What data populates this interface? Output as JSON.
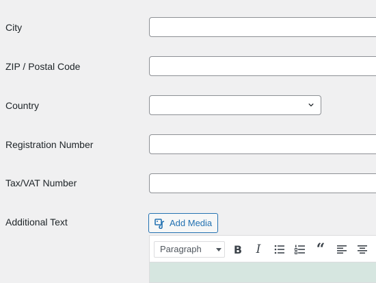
{
  "form": {
    "city_label": "City",
    "city_value": "",
    "zip_label": "ZIP / Postal Code",
    "zip_value": "",
    "country_label": "Country",
    "country_value": "",
    "registration_label": "Registration Number",
    "registration_value": "",
    "vat_label": "Tax/VAT Number",
    "vat_value": "",
    "additional_label": "Additional Text"
  },
  "editor": {
    "add_media_label": "Add Media",
    "format_select": "Paragraph",
    "toolbar_icons": [
      "bold-icon",
      "italic-icon",
      "bulleted-list-icon",
      "numbered-list-icon",
      "blockquote-icon",
      "align-left-icon",
      "align-center-icon"
    ]
  },
  "colors": {
    "accent": "#2271b1",
    "background": "#f0f0f1",
    "editor_area": "#d6e6e0"
  }
}
